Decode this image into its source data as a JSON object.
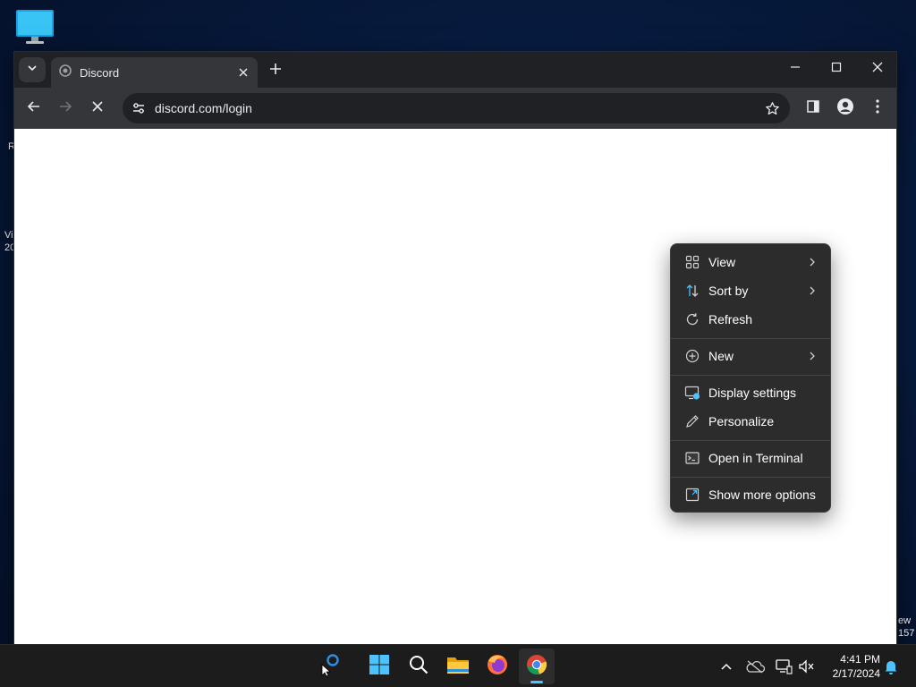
{
  "desktop": {
    "icon": "monitor-icon",
    "left_fragments": [
      "R",
      "Vi",
      "20"
    ],
    "right_fragments": [
      "ew",
      "157"
    ]
  },
  "browser": {
    "tab": {
      "title": "Discord",
      "favicon": "discord-logo-icon"
    },
    "address": {
      "url": "discord.com/login"
    },
    "icons": {
      "tab_search": "chevron-down-icon",
      "new_tab": "plus-icon",
      "back": "back-arrow-icon",
      "forward": "forward-arrow-icon",
      "stop": "stop-loading-icon",
      "site_info": "tune-icon",
      "bookmark": "star-icon",
      "side_panel": "side-panel-icon",
      "profile": "profile-icon",
      "menu": "kebab-menu-icon"
    }
  },
  "context_menu": {
    "items": [
      {
        "label": "View",
        "icon": "grid-icon",
        "submenu": true
      },
      {
        "label": "Sort by",
        "icon": "sort-icon",
        "submenu": true
      },
      {
        "label": "Refresh",
        "icon": "refresh-icon",
        "submenu": false
      },
      {
        "label": "New",
        "icon": "plus-circle-icon",
        "submenu": true
      },
      {
        "label": "Display settings",
        "icon": "display-settings-icon",
        "submenu": false
      },
      {
        "label": "Personalize",
        "icon": "pen-icon",
        "submenu": false
      },
      {
        "label": "Open in Terminal",
        "icon": "terminal-icon",
        "submenu": false
      },
      {
        "label": "Show more options",
        "icon": "expand-icon",
        "submenu": false
      }
    ]
  },
  "taskbar": {
    "apps": [
      "copilot-icon",
      "start-icon",
      "search-icon",
      "file-explorer-icon",
      "firefox-icon",
      "chrome-icon"
    ],
    "tray": [
      "chevron-up-icon",
      "onedrive-icon",
      "network-icon",
      "volume-muted-icon"
    ],
    "clock": {
      "time": "4:41 PM",
      "date": "2/17/2024"
    },
    "notification_icon": "bell-icon"
  },
  "colors": {
    "accent": "#4cc2ff",
    "menu_bg": "#2c2c2c",
    "chrome_dark": "#202124",
    "chrome_toolbar": "#35363a"
  }
}
